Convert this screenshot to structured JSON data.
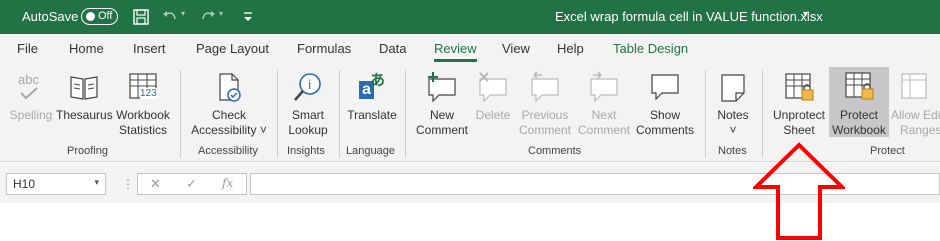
{
  "titlebar": {
    "autosave_label": "AutoSave",
    "autosave_state": "Off",
    "doc_title": "Excel wrap formula cell in VALUE function.xlsx",
    "doc_caret": "▾",
    "bg_color": "#217346"
  },
  "tabs": [
    {
      "label": "File"
    },
    {
      "label": "Home"
    },
    {
      "label": "Insert"
    },
    {
      "label": "Page Layout"
    },
    {
      "label": "Formulas"
    },
    {
      "label": "Data"
    },
    {
      "label": "Review",
      "active": true
    },
    {
      "label": "View"
    },
    {
      "label": "Help"
    },
    {
      "label": "Table Design"
    }
  ],
  "ribbon": {
    "groups": {
      "proofing": "Proofing",
      "accessibility": "Accessibility",
      "insights": "Insights",
      "language": "Language",
      "comments": "Comments",
      "notes": "Notes",
      "protect": "Protect"
    },
    "buttons": {
      "spelling": {
        "icon_text": "abc",
        "label1": "Spelling",
        "enabled": false
      },
      "thesaurus": {
        "label1": "Thesaurus",
        "enabled": true
      },
      "workbook_statistics": {
        "icon_text": "123",
        "label1": "Workbook",
        "label2": "Statistics",
        "enabled": true
      },
      "check_accessibility": {
        "label1": "Check",
        "label2": "Accessibility ˅",
        "enabled": true
      },
      "smart_lookup": {
        "label1": "Smart",
        "label2": "Lookup",
        "enabled": true
      },
      "translate": {
        "icon_text": "a",
        "icon_text2": "あ",
        "label1": "Translate",
        "enabled": true
      },
      "new_comment": {
        "label1": "New",
        "label2": "Comment",
        "enabled": true
      },
      "delete": {
        "label1": "Delete",
        "enabled": false
      },
      "previous_comment": {
        "label1": "Previous",
        "label2": "Comment",
        "enabled": false
      },
      "next_comment": {
        "label1": "Next",
        "label2": "Comment",
        "enabled": false
      },
      "show_comments": {
        "label1": "Show",
        "label2": "Comments",
        "enabled": true
      },
      "notes": {
        "label1": "Notes",
        "label2": "˅",
        "enabled": true
      },
      "unprotect_sheet": {
        "label1": "Unprotect",
        "label2": "Sheet",
        "enabled": true
      },
      "protect_workbook": {
        "label1": "Protect",
        "label2": "Workbook",
        "enabled": true,
        "selected": true
      },
      "allow_edit_ranges": {
        "label1": "Allow Edi",
        "label2": "Ranges",
        "enabled": false
      }
    }
  },
  "formula_bar": {
    "name_box": "H10",
    "name_caret": "▾",
    "dots": "⋮",
    "cancel_icon": "✕",
    "enter_icon": "✓",
    "fx_icon": "fx",
    "value": ""
  },
  "annotation": {
    "arrow_color": "#ff0000"
  }
}
